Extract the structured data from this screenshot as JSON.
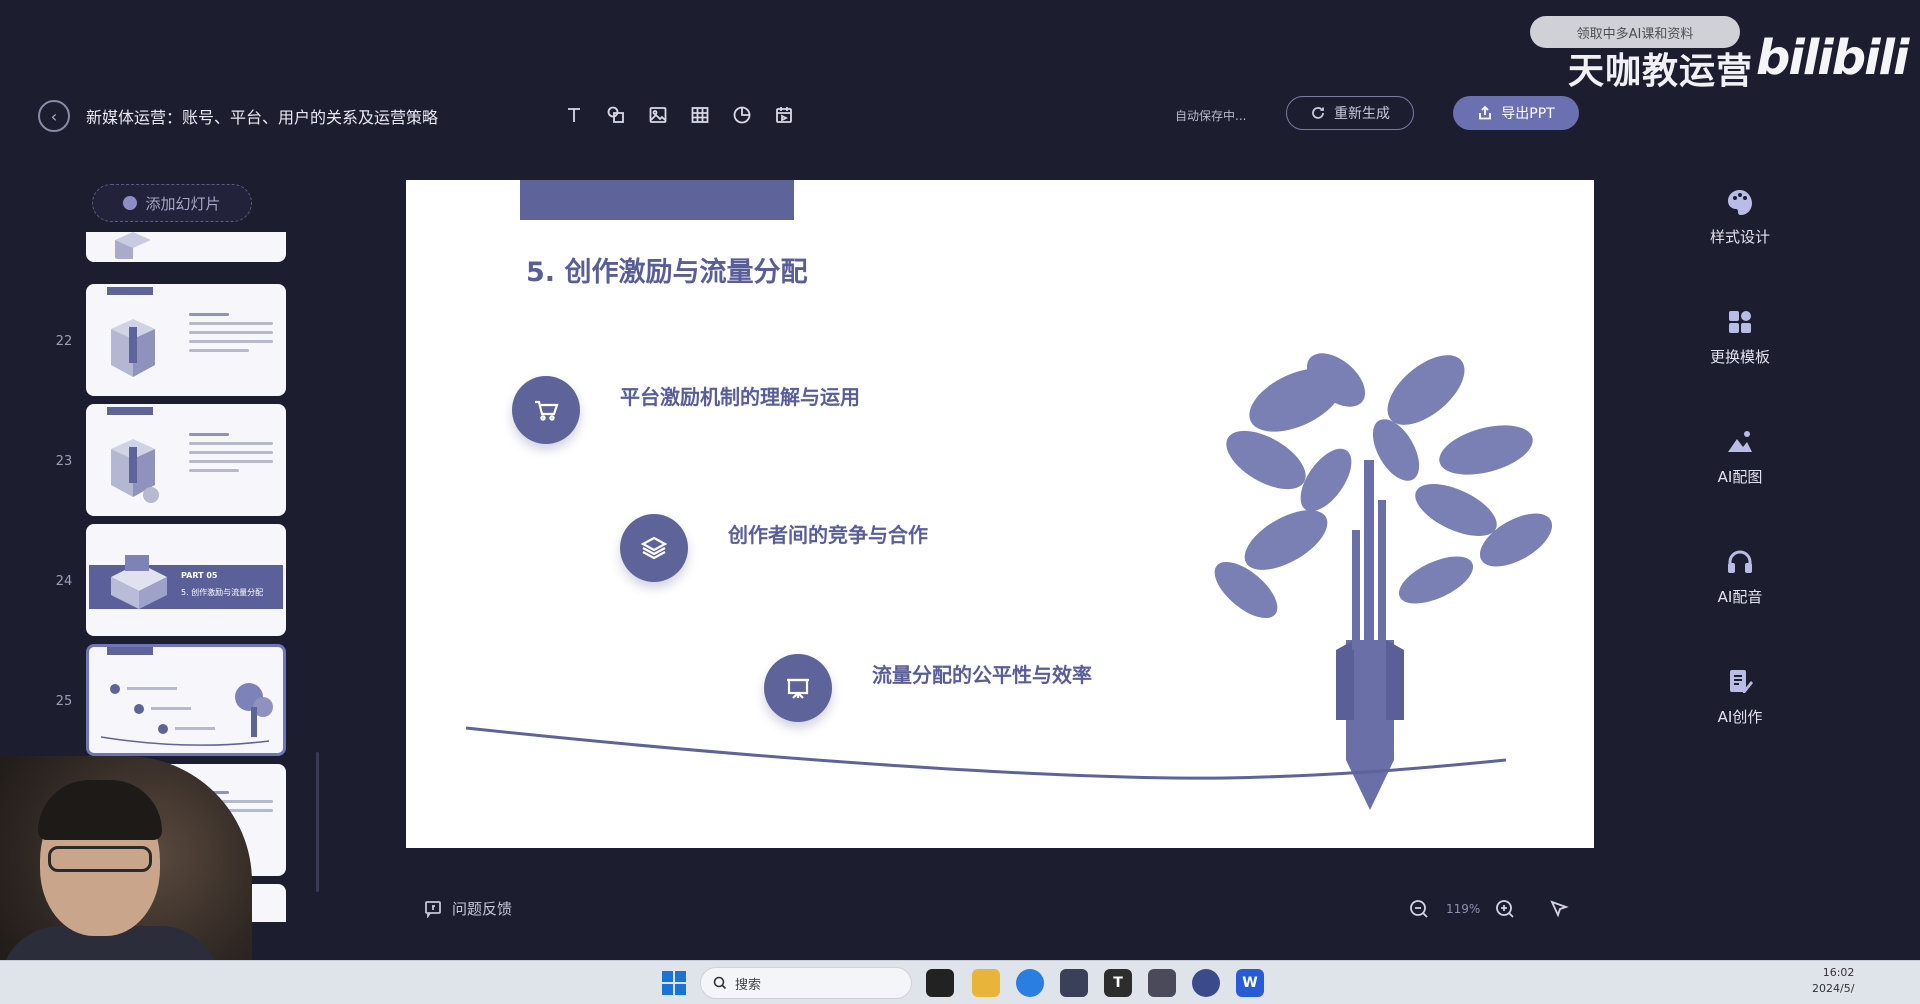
{
  "overlay": {
    "pill_text": "领取中多AI课和资料",
    "brand": "天咖教运营",
    "bili": "bilibili"
  },
  "header": {
    "title": "新媒体运营：账号、平台、用户的关系及运营策略",
    "tools": [
      "text-tool",
      "shape-tool",
      "image-tool",
      "table-tool",
      "chart-tool",
      "media-tool"
    ],
    "autosave": "自动保存中...",
    "regenerate_label": "重新生成",
    "export_label": "导出PPT"
  },
  "sidebar": {
    "add_slide_label": "添加幻灯片",
    "thumbs": [
      {
        "num": "22"
      },
      {
        "num": "23"
      },
      {
        "num": "24",
        "part": "PART 05",
        "part_title": "5. 创作激励与流量分配"
      },
      {
        "num": "25"
      }
    ]
  },
  "slide": {
    "title": "5. 创作激励与流量分配",
    "points": [
      {
        "icon": "cart-icon",
        "text": "平台激励机制的理解与运用"
      },
      {
        "icon": "layers-icon",
        "text": "创作者间的竞争与合作"
      },
      {
        "icon": "presentation-icon",
        "text": "流量分配的公平性与效率"
      }
    ],
    "accent": "#5e6399"
  },
  "rightpanel": {
    "items": [
      {
        "icon": "palette-icon",
        "label": "样式设计"
      },
      {
        "icon": "template-icon",
        "label": "更换模板"
      },
      {
        "icon": "ai-image-icon",
        "label": "AI配图"
      },
      {
        "icon": "ai-voice-icon",
        "label": "AI配音"
      },
      {
        "icon": "ai-write-icon",
        "label": "AI创作"
      }
    ]
  },
  "footer": {
    "feedback_label": "问题反馈",
    "zoom": "119%"
  },
  "taskbar": {
    "search_placeholder": "搜索",
    "time": "16:02",
    "date": "2024/5/"
  }
}
